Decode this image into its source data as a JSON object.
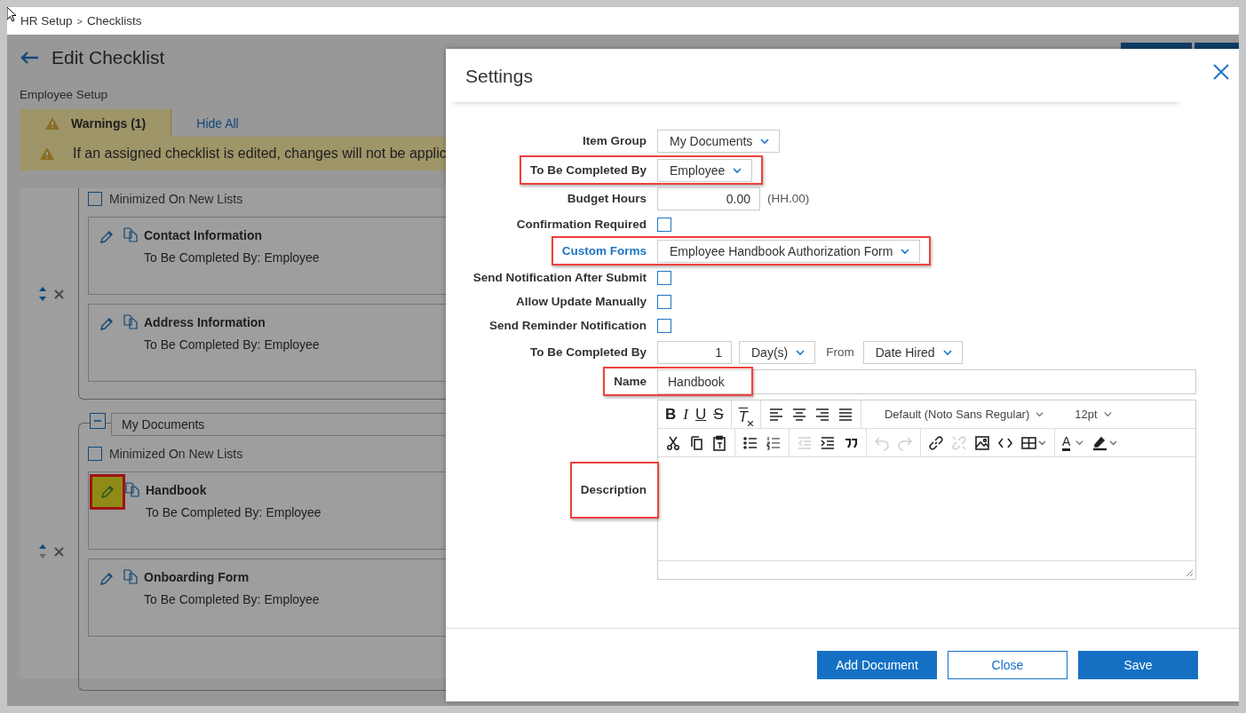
{
  "breadcrumb": [
    {
      "label": "HR Setup",
      "kind": "link"
    },
    {
      "label": ">",
      "kind": "separator"
    },
    {
      "label": "Checklists",
      "kind": "current"
    }
  ],
  "page": {
    "title": "Edit Checklist",
    "subtitle": "Employee Setup",
    "tabs": [
      {
        "label": "Warnings (1)",
        "selected": true,
        "kind": "warning"
      },
      {
        "label": "Hide All",
        "selected": false,
        "kind": "link"
      }
    ],
    "warning": "If an assigned checklist is edited, changes will not be applic"
  },
  "groups": [
    {
      "minimized_label": "Minimized On New Lists",
      "minimized_checked": false,
      "items": [
        {
          "name": "Contact Information",
          "completed_by": "To Be Completed By: Employee",
          "highlighted": false
        },
        {
          "name": "Address Information",
          "completed_by": "To Be Completed By: Employee",
          "highlighted": false
        }
      ]
    },
    {
      "header": "My Documents",
      "expanded": true,
      "minimized_label": "Minimized On New Lists",
      "minimized_checked": false,
      "items": [
        {
          "name": "Handbook",
          "completed_by": "To Be Completed By: Employee",
          "highlighted": true
        },
        {
          "name": "Onboarding Form",
          "completed_by": "To Be Completed By: Employee",
          "highlighted": false
        }
      ]
    }
  ],
  "dialog": {
    "title": "Settings",
    "fields": [
      {
        "kind": "select",
        "label": "Item Group",
        "value": "My Documents",
        "highlighted": false,
        "label_link": false
      },
      {
        "kind": "select",
        "label": "To Be Completed By",
        "value": "Employee",
        "highlighted": true,
        "label_link": false
      },
      {
        "kind": "number",
        "label": "Budget Hours",
        "value": "0.00",
        "suffix": "(HH.00)",
        "highlighted": false,
        "label_link": false
      },
      {
        "kind": "checkbox",
        "label": "Confirmation Required",
        "checked": false,
        "highlighted": false,
        "label_link": false
      },
      {
        "kind": "select",
        "label": "Custom Forms",
        "value": "Employee Handbook Authorization Form",
        "highlighted": true,
        "label_link": true
      },
      {
        "kind": "checkbox",
        "label": "Send Notification After Submit",
        "checked": false,
        "highlighted": false,
        "label_link": false
      },
      {
        "kind": "checkbox",
        "label": "Allow Update Manually",
        "checked": false,
        "highlighted": false,
        "label_link": false
      },
      {
        "kind": "checkbox",
        "label": "Send Reminder Notification",
        "checked": false,
        "highlighted": false,
        "label_link": false
      },
      {
        "kind": "due",
        "label": "To Be Completed By",
        "value": "1",
        "unit": "Day(s)",
        "from_label": "From",
        "from_value": "Date Hired",
        "highlighted": false,
        "label_link": false
      },
      {
        "kind": "text",
        "label": "Name",
        "value": "Handbook",
        "highlighted": true,
        "label_link": false
      },
      {
        "kind": "editor",
        "label": "Description",
        "highlighted": true,
        "label_link": false,
        "toolbar": [
          [
            [
              {
                "kind": "bold",
                "text": "B",
                "disabled": false
              },
              {
                "kind": "italic",
                "text": "I",
                "disabled": false
              },
              {
                "kind": "underline",
                "text": "U",
                "disabled": false
              },
              {
                "kind": "strike",
                "text": "S",
                "disabled": false
              }
            ],
            [
              {
                "kind": "clear-format",
                "text": "T",
                "disabled": false
              }
            ],
            [
              {
                "kind": "align-left",
                "disabled": false
              },
              {
                "kind": "align-center",
                "disabled": false
              },
              {
                "kind": "align-right",
                "disabled": false
              },
              {
                "kind": "justify",
                "disabled": false
              }
            ],
            [
              {
                "kind": "dropdown",
                "text": "Default (Noto Sans Regular)",
                "disabled": false
              },
              {
                "kind": "dropdown",
                "text": "12pt",
                "disabled": false
              }
            ]
          ],
          [
            [
              {
                "kind": "cut",
                "disabled": false
              },
              {
                "kind": "copy",
                "disabled": false
              },
              {
                "kind": "paste",
                "disabled": false
              }
            ],
            [
              {
                "kind": "bullets",
                "disabled": false
              },
              {
                "kind": "numbers",
                "disabled": false
              }
            ],
            [
              {
                "kind": "outdent",
                "disabled": true
              },
              {
                "kind": "indent",
                "disabled": false
              },
              {
                "kind": "quote",
                "disabled": false
              }
            ],
            [
              {
                "kind": "undo",
                "disabled": true
              },
              {
                "kind": "redo",
                "disabled": true
              }
            ],
            [
              {
                "kind": "link",
                "disabled": false
              },
              {
                "kind": "unlink",
                "disabled": true
              },
              {
                "kind": "image",
                "disabled": false
              },
              {
                "kind": "code",
                "disabled": false
              },
              {
                "kind": "table",
                "disabled": false
              }
            ],
            [
              {
                "kind": "text-color",
                "text": "A",
                "disabled": false
              },
              {
                "kind": "highlight",
                "disabled": false
              }
            ]
          ]
        ]
      }
    ],
    "buttons": [
      {
        "label": "Add Document",
        "kind": "primary"
      },
      {
        "label": "Close",
        "kind": "secondary"
      },
      {
        "label": "Save",
        "kind": "primary"
      }
    ]
  }
}
